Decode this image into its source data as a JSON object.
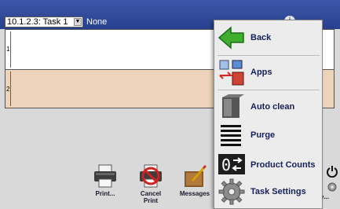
{
  "header": {
    "task_selector": "10.1.2.3: Task 1",
    "job_name": "None"
  },
  "lines": [
    {
      "number": "1"
    },
    {
      "number": "2"
    }
  ],
  "toolbar": {
    "print_label": "Print...",
    "cancel_label_1": "Cancel",
    "cancel_label_2": "Print",
    "messages_label": "Messages",
    "more_label": "ore..."
  },
  "menu": {
    "items": [
      {
        "label": "Back",
        "icon": "back-arrow-icon"
      },
      {
        "label": "Apps",
        "icon": "apps-icon"
      },
      {
        "label": "Auto clean",
        "icon": "auto-clean-icon"
      },
      {
        "label": "Purge",
        "icon": "purge-icon"
      },
      {
        "label": "Product Counts",
        "icon": "product-counts-icon"
      },
      {
        "label": "Task Settings",
        "icon": "gear-icon"
      }
    ]
  },
  "colors": {
    "header_blue": "#2f479a",
    "line2_bg": "#ecd3b9",
    "back_green": "#3fae2f"
  }
}
